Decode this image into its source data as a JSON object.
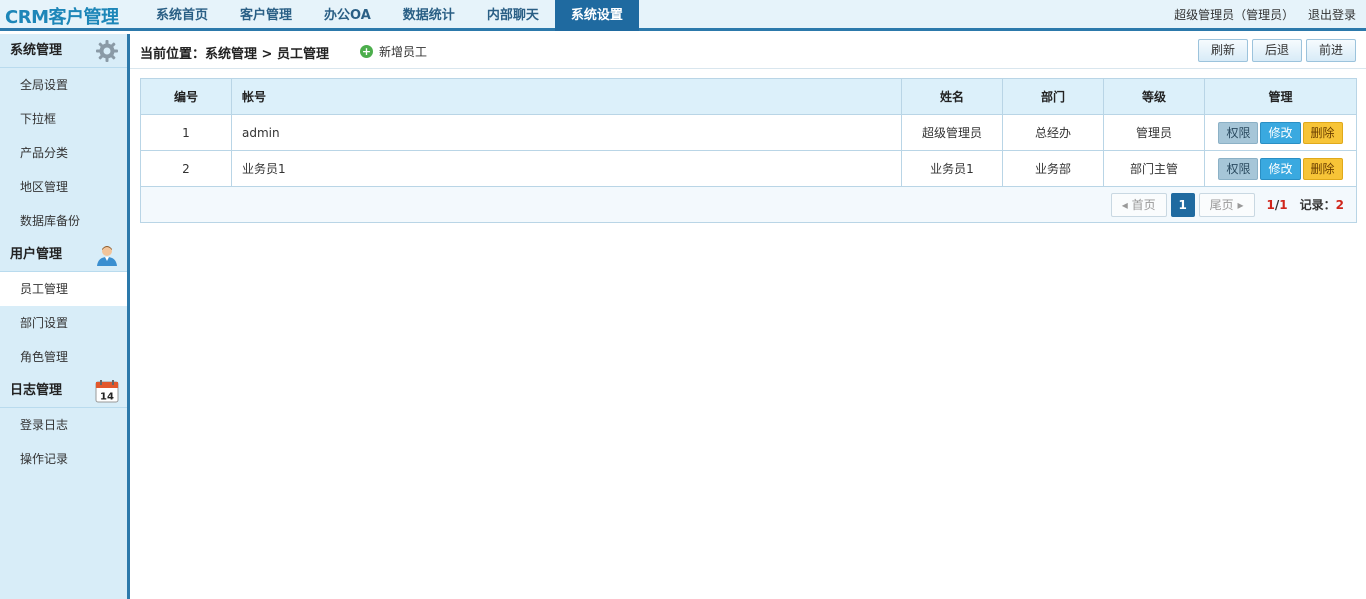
{
  "app": {
    "logo": "CRM客户管理"
  },
  "nav": [
    {
      "label": "系统首页"
    },
    {
      "label": "客户管理"
    },
    {
      "label": "办公OA"
    },
    {
      "label": "数据统计"
    },
    {
      "label": "内部聊天"
    },
    {
      "label": "系统设置",
      "active": true
    }
  ],
  "user": {
    "name": "超级管理员（管理员）",
    "logout": "退出登录"
  },
  "sidebar": {
    "sections": [
      {
        "title": "系统管理",
        "icon": "gear-icon",
        "items": [
          "全局设置",
          "下拉框",
          "产品分类",
          "地区管理",
          "数据库备份"
        ]
      },
      {
        "title": "用户管理",
        "icon": "user-icon",
        "items": [
          "员工管理",
          "部门设置",
          "角色管理"
        ],
        "active": "员工管理"
      },
      {
        "title": "日志管理",
        "icon": "calendar-icon",
        "calendar_day": "14",
        "items": [
          "登录日志",
          "操作记录"
        ]
      }
    ]
  },
  "breadcrumb": {
    "text": "当前位置：系统管理 > 员工管理"
  },
  "add_button": {
    "label": "新增员工"
  },
  "toolbar": {
    "refresh": "刷新",
    "back": "后退",
    "forward": "前进"
  },
  "table": {
    "headers": [
      "编号",
      "帐号",
      "姓名",
      "部门",
      "等级",
      "管理"
    ],
    "rows": [
      {
        "id": "1",
        "account": "admin",
        "name": "超级管理员",
        "dept": "总经办",
        "level": "管理员"
      },
      {
        "id": "2",
        "account": "业务员1",
        "name": "业务员1",
        "dept": "业务部",
        "level": "部门主管"
      }
    ],
    "actions": {
      "perm": "权限",
      "edit": "修改",
      "del": "删除"
    }
  },
  "pager": {
    "first": "首页",
    "last": "尾页",
    "current": "1",
    "page_current": "1",
    "page_sep": "/",
    "page_total": "1",
    "records_label": "记录：",
    "records": "2"
  },
  "colors": {
    "accent": "#1f6aa0",
    "sidebar_bg": "#d8edf8",
    "header_bg": "#dcf0fa"
  }
}
